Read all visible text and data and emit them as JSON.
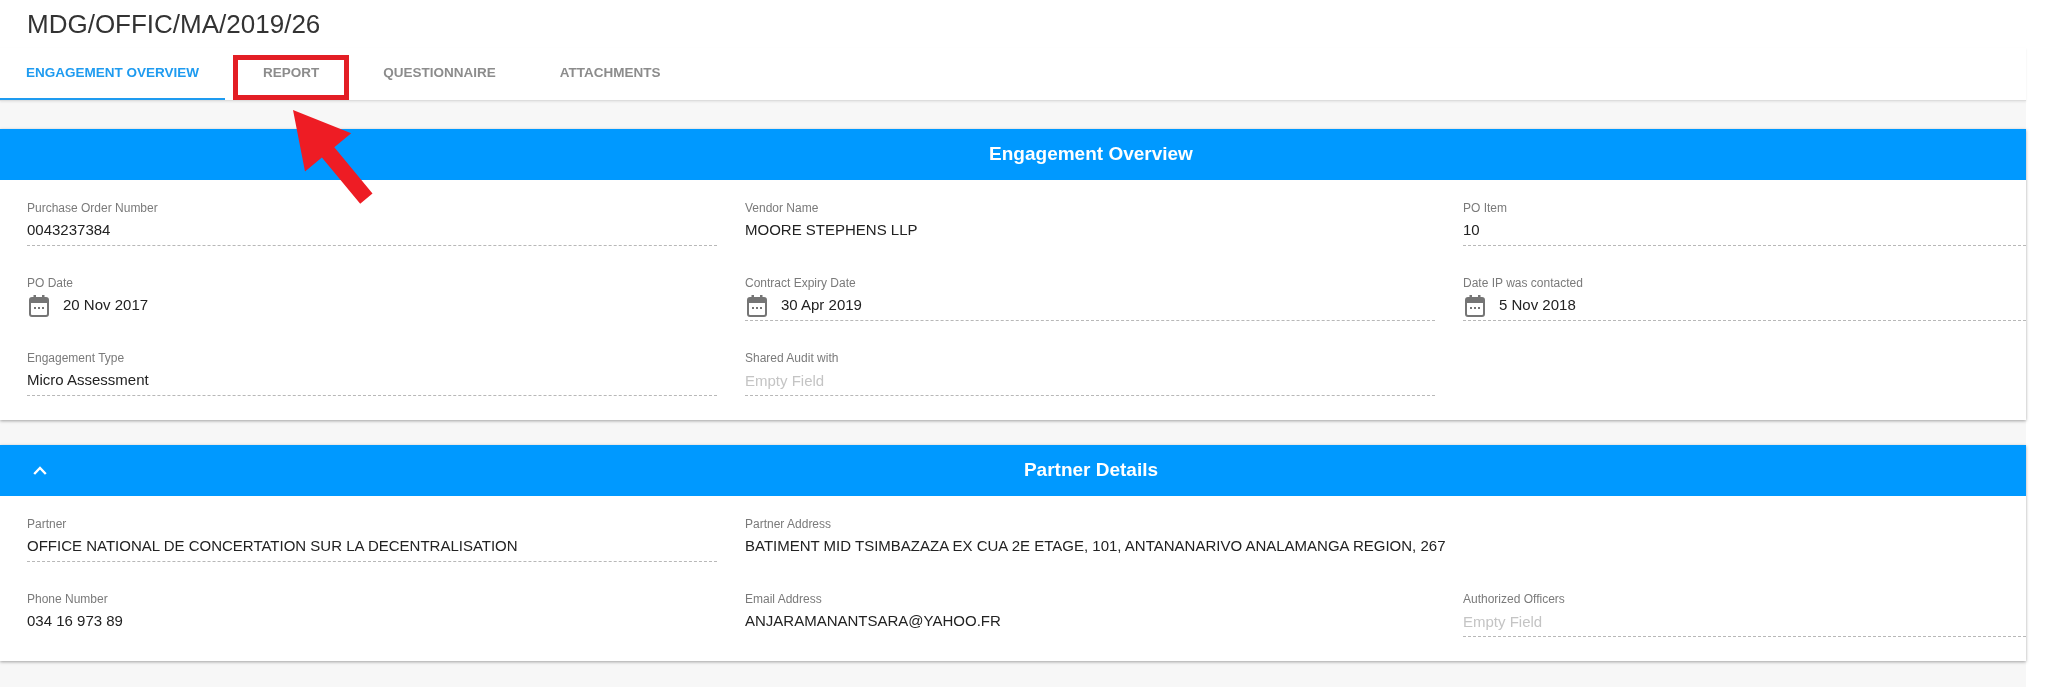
{
  "page": {
    "title": "MDG/OFFIC/MA/2019/26"
  },
  "tabs": [
    {
      "label": "ENGAGEMENT OVERVIEW",
      "selected": true,
      "highlighted": false
    },
    {
      "label": "REPORT",
      "selected": false,
      "highlighted": true
    },
    {
      "label": "QUESTIONNAIRE",
      "selected": false,
      "highlighted": false
    },
    {
      "label": "ATTACHMENTS",
      "selected": false,
      "highlighted": false
    }
  ],
  "sections": [
    {
      "title": "Engagement Overview",
      "rows": [
        [
          {
            "kind": "text",
            "label": "Purchase Order Number",
            "value": "0043237384",
            "underlined": true
          },
          {
            "kind": "text",
            "label": "Vendor Name",
            "value": "MOORE STEPHENS LLP",
            "underlined": false
          },
          {
            "kind": "text",
            "label": "PO Item",
            "value": "10",
            "underlined": true
          }
        ],
        [
          {
            "kind": "date",
            "label": "PO Date",
            "value": "20 Nov 2017",
            "underlined": false
          },
          {
            "kind": "date",
            "label": "Contract Expiry Date",
            "value": "30 Apr 2019",
            "underlined": true
          },
          {
            "kind": "date",
            "label": "Date IP was contacted",
            "value": "5 Nov 2018",
            "underlined": true
          }
        ],
        [
          {
            "kind": "text",
            "label": "Engagement Type",
            "value": "Micro Assessment",
            "underlined": true
          },
          {
            "kind": "text",
            "label": "Shared Audit with",
            "placeholder": "Empty Field",
            "underlined": true
          }
        ]
      ]
    },
    {
      "title": "Partner Details",
      "expanded": true,
      "rows": [
        [
          {
            "kind": "text",
            "label": "Partner",
            "value": "OFFICE NATIONAL DE CONCERTATION SUR LA DECENTRALISATION",
            "underlined": true
          },
          {
            "kind": "text",
            "label": "Partner Address",
            "value": "BATIMENT MID TSIMBAZAZA EX CUA 2E ETAGE, 101, ANTANANARIVO ANALAMANGA REGION, 267",
            "underlined": false
          }
        ],
        [
          {
            "kind": "text",
            "label": "Phone Number",
            "value": "034 16 973 89",
            "underlined": false
          },
          {
            "kind": "text",
            "label": "Email Address",
            "value": "ANJARAMANANTSARA@YAHOO.FR",
            "underlined": false
          },
          {
            "kind": "text",
            "label": "Authorized Officers",
            "placeholder": "Empty Field",
            "underlined": true
          }
        ]
      ]
    }
  ]
}
